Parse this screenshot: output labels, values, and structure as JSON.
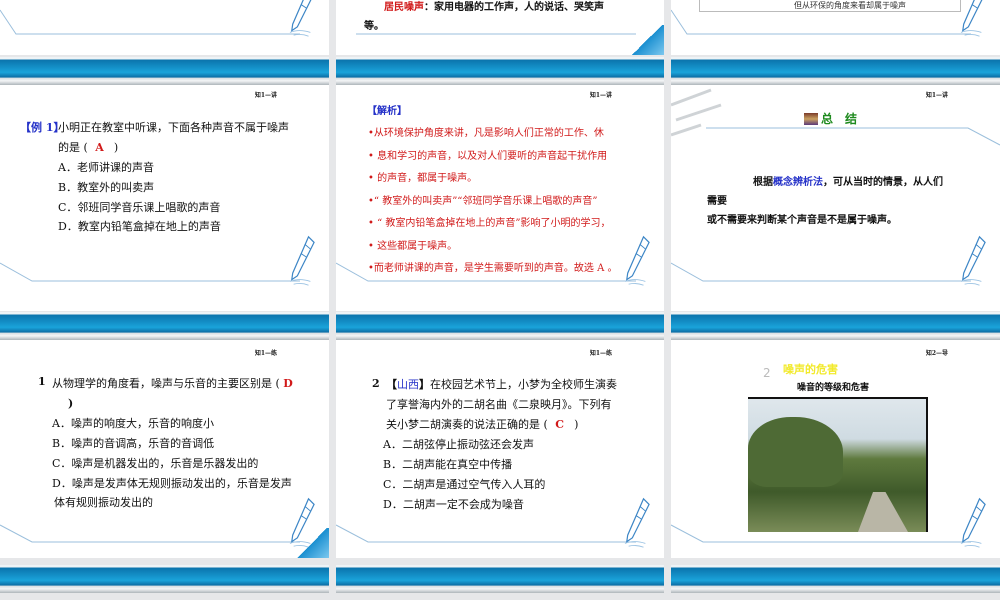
{
  "header_tags": {
    "lecture": "知1—讲",
    "practice": "知1—练",
    "lecture2": "知2—导"
  },
  "s_top2": {
    "label": "居民噪声",
    "text": "：家用电器的工作声，人的说话、哭笑声",
    "text2": "等。"
  },
  "s_top3": {
    "cell": "但从环保的角度来看却属于噪声"
  },
  "s_ex1": {
    "tag": "【例 1】",
    "q1": "小明正在教室中听课，下面各种声音不属于噪声",
    "q2a": "的是 (",
    "answer": "A",
    "q2b": ")",
    "options": [
      "A．老师讲课的声音",
      "B．教室外的叫卖声",
      "C．邻班同学音乐课上唱歌的声音",
      "D．教室内铅笔盒掉在地上的声音"
    ]
  },
  "s_analysis": {
    "title": "【解析】",
    "lines": [
      "•从环境保护角度来讲，凡是影响人们正常的工作、休",
      "•  息和学习的声音，以及对人们要听的声音起干扰作用",
      "•  的声音，都属于噪声。",
      "•“ 教室外的叫卖声”“邻班同学音乐课上唱歌的声音”",
      "• “ 教室内铅笔盒掉在地上的声音”影响了小明的学习，",
      "•    这些都属于噪声。",
      "•而老师讲课的声音，是学生需要听到的声音。故选 A 。"
    ]
  },
  "s_summary": {
    "title": "总　结",
    "pre": "根据",
    "method": "概念辨析法",
    "post": "，可从当时的情景，从人们",
    "line2": "需要",
    "line3": "或不需要来判断某个声音是不是属于噪声。"
  },
  "s_q1": {
    "num": "1",
    "q1": "从物理学的角度看，噪声与乐音的主要区别是 (",
    "answer": "D",
    "q2": ")",
    "options": [
      "A．噪声的响度大，乐音的响度小",
      "B．噪声的音调高，乐音的音调低",
      "C．噪声是机器发出的，乐音是乐器发出的",
      "D．噪声是发声体无规则振动发出的，乐音是发声"
    ],
    "cont": "体有规则振动发出的"
  },
  "s_q2": {
    "num": "2",
    "src_l": "【",
    "src": "山西",
    "src_r": "】",
    "q1": "在校园艺术节上，小梦为全校师生演奏",
    "q2": "了享誉海内外的二胡名曲《二泉映月》。下列有",
    "q3a": "关小梦二胡演奏的说法正确的是 (",
    "answer": "C",
    "q3b": ")",
    "options": [
      "A．二胡弦停止振动弦还会发声",
      "B．二胡声能在真空中传播",
      "C．二胡声是通过空气传入人耳的",
      "D．二胡声一定不会成为噪音"
    ]
  },
  "s_harm": {
    "num": "2",
    "title": "噪声的危害",
    "subtitle": "噪音的等级和危害"
  }
}
